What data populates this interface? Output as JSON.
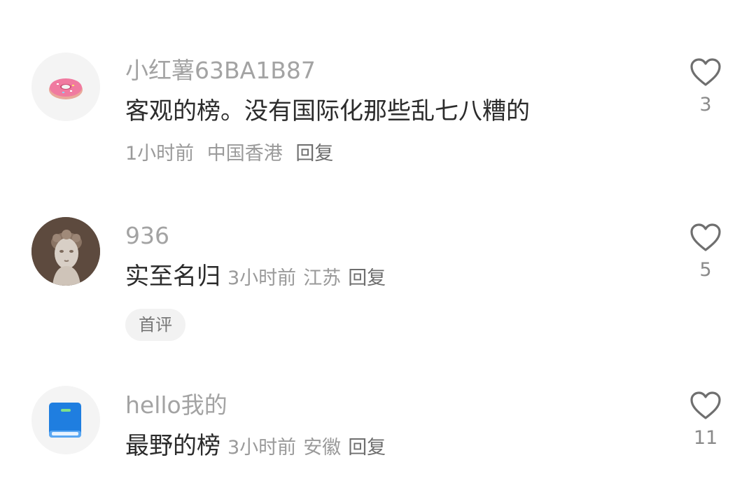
{
  "comments": [
    {
      "username": "小红薯63BA1B87",
      "text": "客观的榜。没有国际化那些乱七八糟的",
      "time": "1小时前",
      "location": "中国香港",
      "reply": "回复",
      "likes": "3",
      "avatar_icon": "donut-icon"
    },
    {
      "username": "936",
      "text": "实至名归",
      "time": "3小时前",
      "location": "江苏",
      "reply": "回复",
      "likes": "5",
      "badge": "首评",
      "avatar_icon": "statue-bust-icon"
    },
    {
      "username": "hello我的",
      "text": "最野的榜",
      "time": "3小时前",
      "location": "安徽",
      "reply": "回复",
      "likes": "11",
      "avatar_icon": "blue-book-icon"
    }
  ],
  "colors": {
    "username": "#a3a3a3",
    "text": "#2b2b2b",
    "meta": "#9a9a9a",
    "badge_bg": "#f2f2f2"
  }
}
